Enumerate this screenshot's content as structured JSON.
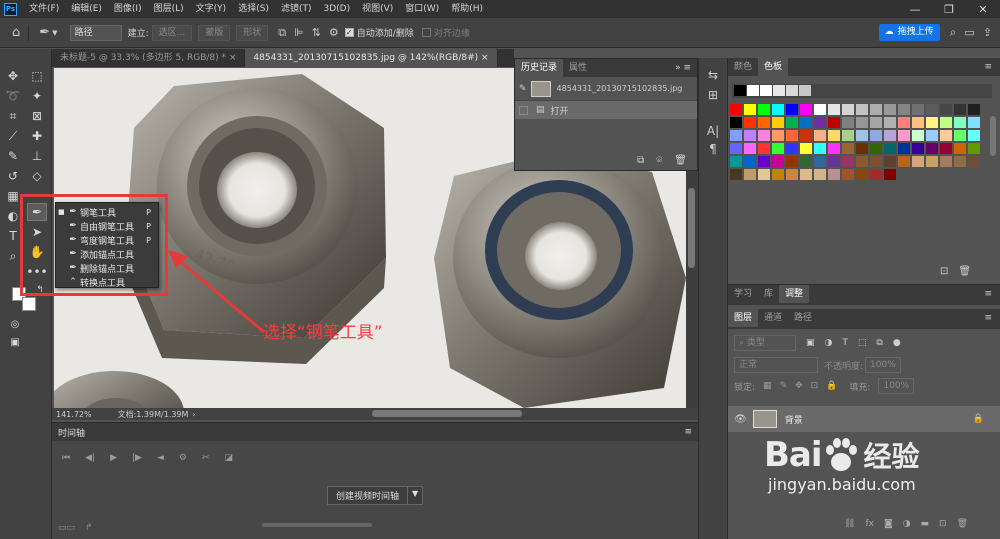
{
  "menubar": {
    "logo": "Ps",
    "items": [
      "文件(F)",
      "编辑(E)",
      "图像(I)",
      "图层(L)",
      "文字(Y)",
      "选择(S)",
      "滤镜(T)",
      "3D(D)",
      "视图(V)",
      "窗口(W)",
      "帮助(H)"
    ],
    "window_buttons": [
      "—",
      "❐",
      "✕"
    ]
  },
  "options": {
    "mode_value": "路径",
    "build_label": "建立:",
    "selection_btn": "选区...",
    "mask_btn": "蒙版",
    "shape_btn": "形状",
    "auto_add_delete": "自动添加/删除",
    "align_edges": "对齐边缘",
    "share_button": "拖拽上传"
  },
  "tabs": [
    {
      "label": "未标题-5 @ 33.3% (多边形 5, RGB/8) *",
      "close": "×"
    },
    {
      "label": "4854331_20130715102835.jpg @ 142%(RGB/8#)",
      "close": "×"
    }
  ],
  "status": {
    "zoom": "141.72%",
    "doc": "文档:1.39M/1.39M"
  },
  "history": {
    "tabs": [
      "历史记录",
      "属性"
    ],
    "snapshot": "4854331_20130715102835.jpg",
    "step": "打开"
  },
  "flyout": {
    "items": [
      {
        "label": "钢笔工具",
        "shortcut": "P",
        "icon": "pen-icon"
      },
      {
        "label": "自由钢笔工具",
        "shortcut": "P",
        "icon": "freeform-pen-icon"
      },
      {
        "label": "弯度钢笔工具",
        "shortcut": "P",
        "icon": "curvature-pen-icon"
      },
      {
        "label": "添加锚点工具",
        "shortcut": "",
        "icon": "add-anchor-icon"
      },
      {
        "label": "删除锚点工具",
        "shortcut": "",
        "icon": "delete-anchor-icon"
      },
      {
        "label": "转换点工具",
        "shortcut": "",
        "icon": "convert-point-icon"
      }
    ]
  },
  "annotation": "选择“钢笔工具”",
  "timeline": {
    "title": "时间轴",
    "create_button": "创建视频时间轴"
  },
  "swatches": {
    "tabs": [
      "颜色",
      "色板"
    ],
    "recent": [
      "#000000",
      "#ffffff",
      "#ffffff",
      "#e8e8e8",
      "#d8d8d8",
      "#c8c8c8"
    ],
    "colors": [
      "#ff0000",
      "#ffff00",
      "#00ff00",
      "#00ffff",
      "#0000ff",
      "#ff00ff",
      "#ffffff",
      "#e6e6e6",
      "#d4d4d4",
      "#c2c2c2",
      "#adadad",
      "#999999",
      "#858585",
      "#707070",
      "#5c5c5c",
      "#474747",
      "#333333",
      "#1f1f1f",
      "#000000",
      "#ff3300",
      "#ff6600",
      "#ffcc00",
      "#00b050",
      "#0070c0",
      "#7030a0",
      "#c00000",
      "#808080",
      "#969696",
      "#a6a6a6",
      "#b0b0b0",
      "#ff7f7f",
      "#ffbf7f",
      "#fff27f",
      "#bfff7f",
      "#7fffbf",
      "#7fdfff",
      "#7f9fff",
      "#bf7fff",
      "#ff7fdf",
      "#ff9966",
      "#ff6633",
      "#cc3300",
      "#f4b183",
      "#ffd966",
      "#a9d18e",
      "#9dc3e6",
      "#8faadc",
      "#b4a7d6",
      "#ff99cc",
      "#ccffcc",
      "#99ccff",
      "#ffcc99",
      "#66ff66",
      "#66ffff",
      "#6666ff",
      "#ff66ff",
      "#ff3333",
      "#33ff33",
      "#3333ff",
      "#ffff33",
      "#33ffff",
      "#ff33ff",
      "#996633",
      "#663300",
      "#336600",
      "#006666",
      "#003399",
      "#330099",
      "#660066",
      "#990033",
      "#cc6600",
      "#669900",
      "#009999",
      "#0066cc",
      "#6600cc",
      "#cc0099",
      "#993300",
      "#336633",
      "#336699",
      "#663399",
      "#993366",
      "#8b5a2b",
      "#7a5230",
      "#5c4033",
      "#b5651d",
      "#d2a679",
      "#c8a165",
      "#a67b5b",
      "#8c6d46",
      "#6f4e37",
      "#4b3621",
      "#c19a6b",
      "#e1c699",
      "#b8860b",
      "#cd853f",
      "#deb887",
      "#d2b48c",
      "#bc8f8f",
      "#a0522d",
      "#8b4513",
      "#a52a2a",
      "#800000"
    ]
  },
  "layers": {
    "tabs": [
      "学习",
      "库",
      "调整"
    ],
    "subtabs": [
      "图层",
      "通道",
      "路径"
    ],
    "filter_label": "类型",
    "blend_mode": "正常",
    "opacity_label": "不透明度:",
    "opacity_value": "100%",
    "lock_label": "锁定:",
    "fill_label": "填充:",
    "fill_value": "100%",
    "layer_name": "背景"
  },
  "watermark": {
    "brand": "Bai",
    "brand2": "经验",
    "url": "jingyan.baidu.com"
  }
}
